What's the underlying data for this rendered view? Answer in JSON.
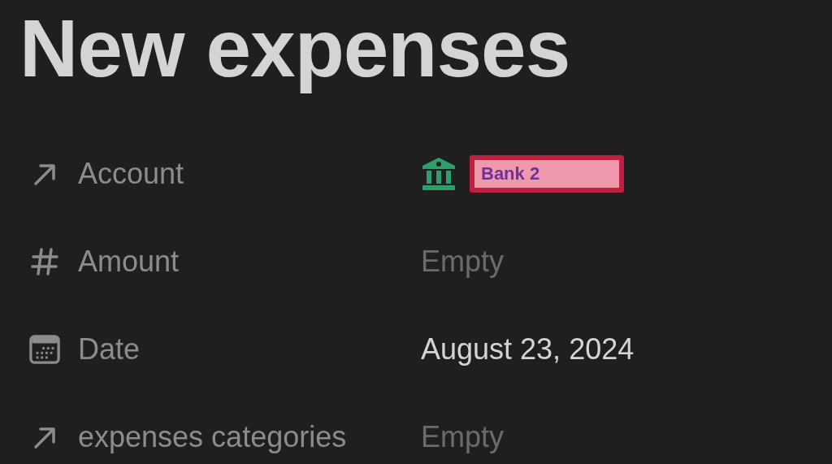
{
  "title": "New expenses",
  "properties": [
    {
      "kind": "relation",
      "label": "Account",
      "value": {
        "kind": "page",
        "text": "Bank 2"
      }
    },
    {
      "kind": "number",
      "label": "Amount",
      "value": {
        "kind": "empty",
        "text": "Empty"
      }
    },
    {
      "kind": "date",
      "label": "Date",
      "value": {
        "kind": "text",
        "text": "August 23, 2024"
      }
    },
    {
      "kind": "relation",
      "label": "expenses categories",
      "value": {
        "kind": "empty",
        "text": "Empty"
      }
    }
  ]
}
